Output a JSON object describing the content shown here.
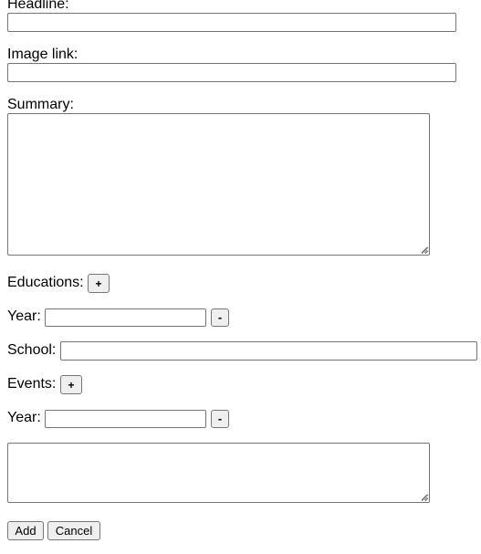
{
  "form": {
    "headline_label": "Headline:",
    "headline_value": "",
    "image_link_label": "Image link:",
    "image_link_value": "",
    "summary_label": "Summary:",
    "summary_value": "",
    "educations": {
      "label": "Educations:",
      "add_label": "+",
      "entries": [
        {
          "year_label": "Year:",
          "year_value": "",
          "remove_label": "-",
          "school_label": "School:",
          "school_value": ""
        }
      ]
    },
    "events": {
      "label": "Events:",
      "add_label": "+",
      "entries": [
        {
          "year_label": "Year:",
          "year_value": "",
          "remove_label": "-",
          "description_value": ""
        }
      ]
    },
    "add_button_label": "Add",
    "cancel_button_label": "Cancel"
  }
}
